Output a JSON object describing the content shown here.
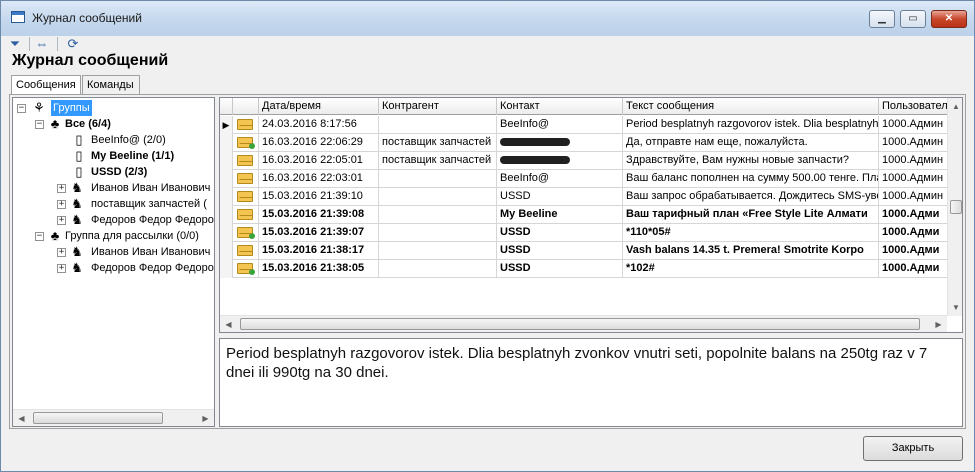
{
  "window": {
    "title": "Журнал сообщений"
  },
  "page": {
    "heading": "Журнал сообщений"
  },
  "toolbar": {
    "filter_icon": "filter-icon",
    "swap_icon": "swap-arrows-icon",
    "refresh_icon": "refresh-icon"
  },
  "tabs": [
    {
      "label": "Сообщения"
    },
    {
      "label": "Команды"
    }
  ],
  "tree": {
    "items": [
      {
        "label": "Группы",
        "icon": "group-root-icon",
        "expander": "−",
        "selected": true
      },
      {
        "label": "Все (6/4)",
        "icon": "group-icon",
        "expander": "−",
        "bold": true
      },
      {
        "label": "BeeInfo@ (2/0)",
        "icon": "phone-icon",
        "expander": ""
      },
      {
        "label": "My Beeline (1/1)",
        "icon": "phone-icon",
        "expander": "",
        "bold": true
      },
      {
        "label": "USSD (2/3)",
        "icon": "phone-icon",
        "expander": "",
        "bold": true
      },
      {
        "label": "Иванов Иван Иванович",
        "icon": "contact-icon",
        "expander": "+"
      },
      {
        "label": "поставщик запчастей (",
        "icon": "contact-icon",
        "expander": "+"
      },
      {
        "label": "Федоров Федор Федоров",
        "icon": "contact-icon",
        "expander": "+"
      },
      {
        "label": "Группа для рассылки (0/0)",
        "icon": "group-icon",
        "expander": "−"
      },
      {
        "label": "Иванов Иван Иванович",
        "icon": "contact-icon",
        "expander": "+"
      },
      {
        "label": "Федоров Федор Федоров",
        "icon": "contact-icon",
        "expander": "+"
      }
    ]
  },
  "grid": {
    "columns": [
      {
        "label": ""
      },
      {
        "label": "Дата/время"
      },
      {
        "label": "Контрагент"
      },
      {
        "label": "Контакт"
      },
      {
        "label": "Текст сообщения"
      },
      {
        "label": "Пользовател"
      }
    ],
    "rows": [
      {
        "dir": "in",
        "date": "24.03.2016 8:17:56",
        "party": "",
        "contact": "BeeInfo@",
        "text": "Period besplatnyh razgovorov istek. Dlia besplatnyh z",
        "user": "1000.Админ",
        "bold": false,
        "current": true
      },
      {
        "dir": "out",
        "date": "16.03.2016 22:06:29",
        "party": "поставщик запчастей",
        "contact": "",
        "text": "Да, отправте нам еще, пожалуйста.",
        "user": "1000.Админ",
        "bold": false,
        "redacted": true
      },
      {
        "dir": "in",
        "date": "16.03.2016 22:05:01",
        "party": "поставщик запчастей",
        "contact": "",
        "text": "Здравствуйте, Вам нужны новые запчасти?",
        "user": "1000.Админ",
        "bold": false,
        "redacted": true
      },
      {
        "dir": "in",
        "date": "16.03.2016 22:03:01",
        "party": "",
        "contact": "BeeInfo@",
        "text": "Ваш баланс пополнен на сумму 500.00 тенге. Плат",
        "user": "1000.Админ",
        "bold": false
      },
      {
        "dir": "in",
        "date": "15.03.2016 21:39:10",
        "party": "",
        "contact": "USSD",
        "text": "Ваш запрос обрабатывается. Дождитесь SMS-уве",
        "user": "1000.Админ",
        "bold": false
      },
      {
        "dir": "in",
        "date": "15.03.2016 21:39:08",
        "party": "",
        "contact": "My Beeline",
        "text": "Ваш тарифный план «Free Style Lite Алмати",
        "user": "1000.Адми",
        "bold": true
      },
      {
        "dir": "out",
        "date": "15.03.2016 21:39:07",
        "party": "",
        "contact": "USSD",
        "text": "*110*05#",
        "user": "1000.Адми",
        "bold": true
      },
      {
        "dir": "in",
        "date": "15.03.2016 21:38:17",
        "party": "",
        "contact": "USSD",
        "text": "Vash balans 14.35 t. Premera! Smotrite Korpo",
        "user": "1000.Адми",
        "bold": true
      },
      {
        "dir": "out",
        "date": "15.03.2016 21:38:05",
        "party": "",
        "contact": "USSD",
        "text": "*102#",
        "user": "1000.Адми",
        "bold": true
      }
    ]
  },
  "preview": {
    "text": "Period besplatnyh razgovorov istek. Dlia besplatnyh zvonkov vnutri seti, popolnite balans na 250tg raz v 7 dnei ili 990tg na 30 dnei."
  },
  "footer": {
    "close_label": "Закрыть"
  }
}
